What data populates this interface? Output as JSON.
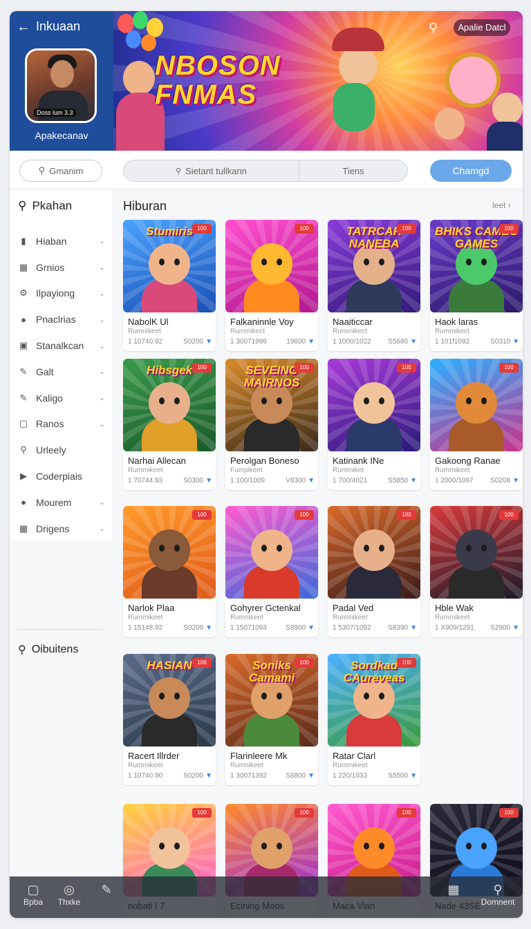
{
  "header": {
    "title": "Inkuaan",
    "profile_name": "Apakecanav",
    "avatar_tag": "Doss lum 3.3",
    "banner_title": "NBOSON FNMAS",
    "banner_pill": "Apalie Datcl"
  },
  "search": {
    "side_placeholder": "Gmanim",
    "main_placeholder": "Sietant tullkann",
    "main_tab": "Tiens",
    "change_button": "Chamgd"
  },
  "sidebar": {
    "heading": "Pkahan",
    "items": [
      {
        "label": "Hiaban",
        "icon": "bookmark-icon",
        "chev": true
      },
      {
        "label": "Grnios",
        "icon": "grid-icon",
        "chev": true
      },
      {
        "label": "Ilpayiong",
        "icon": "gear-icon",
        "chev": true
      },
      {
        "label": "Pnaclrias",
        "icon": "user-icon",
        "chev": true
      },
      {
        "label": "Stanalkcan",
        "icon": "folder-icon",
        "chev": true
      },
      {
        "label": "Galt",
        "icon": "pen-icon",
        "chev": true
      },
      {
        "label": "Kaligo",
        "icon": "pen-icon",
        "chev": true
      },
      {
        "label": "Ranos",
        "icon": "square-icon",
        "chev": true
      },
      {
        "label": "Urleely",
        "icon": "search-user-icon",
        "chev": false
      },
      {
        "label": "Coderpiais",
        "icon": "play-icon",
        "chev": false
      },
      {
        "label": "Mourem",
        "icon": "user-icon",
        "chev": true
      },
      {
        "label": "Drigens",
        "icon": "grid-icon",
        "chev": true
      }
    ],
    "footer": "Oibuitens"
  },
  "main": {
    "section_title": "Hiburan",
    "section_more": "leet"
  },
  "cards": [
    {
      "name": "NabolK Ul",
      "sub": "Rumnikeet",
      "count": "1 10740.92",
      "size": "S0200",
      "tag": "100",
      "thumb_text": "Stumiris",
      "bg": [
        "#4aa3ff",
        "#1a4fb5"
      ],
      "face": "#f0b48a",
      "body": "#d94a7a"
    },
    {
      "name": "Falkaninnle Voy",
      "sub": "Rummikect",
      "count": "1 30071999",
      "size": "19600",
      "tag": "100",
      "thumb_text": "",
      "bg": [
        "#ff4fcf",
        "#b2188f"
      ],
      "face": "#ffb830",
      "body": "#ff8a1f"
    },
    {
      "name": "Naaiticcar",
      "sub": "Rummikect",
      "count": "1 1000/1022",
      "size": "S5680",
      "tag": "100",
      "thumb_text": "TATRCAR NANEBA",
      "bg": [
        "#8a3ad9",
        "#321a7a"
      ],
      "face": "#e3b08a",
      "body": "#2d3a5c"
    },
    {
      "name": "Haok laras",
      "sub": "Rummikect",
      "count": "1 101f1092",
      "size": "S0310",
      "tag": "100",
      "thumb_text": "BHIKS CAMBS GAMES",
      "bg": [
        "#6a3ac9",
        "#2a1a6a"
      ],
      "face": "#4cc96a",
      "body": "#3a7a3a"
    },
    {
      "name": "Narhai Allecan",
      "sub": "Rummikeet",
      "count": "1 70744.93",
      "size": "S0300",
      "tag": "100",
      "thumb_text": "Hibsgek",
      "bg": [
        "#3a9a4a",
        "#1a5a2a"
      ],
      "face": "#e8b08a",
      "body": "#e0a02a"
    },
    {
      "name": "Perolgan Boneso",
      "sub": "Fumpikeet",
      "count": "1 100/1009",
      "size": "V8300",
      "tag": "100",
      "thumb_text": "SEVEING MAIRNOS",
      "bg": [
        "#d98a2a",
        "#3a2a1a"
      ],
      "face": "#c98a5a",
      "body": "#2a2a2a"
    },
    {
      "name": "Katinank INe",
      "sub": "Rummiket",
      "count": "1 700/4021",
      "size": "S5850",
      "tag": "100",
      "thumb_text": "",
      "bg": [
        "#a83ad9",
        "#2a1a7a"
      ],
      "face": "#f0c39a",
      "body": "#2a3a6a"
    },
    {
      "name": "Gakoong Ranae",
      "sub": "Rummikeet",
      "count": "1 2000/1097",
      "size": "S0208",
      "tag": "100",
      "thumb_text": "",
      "bg": [
        "#2ab0ff",
        "#c9308a"
      ],
      "face": "#e08a3a",
      "body": "#a85a2a"
    },
    {
      "name": "Narlok Plaa",
      "sub": "Rummikeet",
      "count": "1 15148.92",
      "size": "S0209",
      "tag": "100",
      "thumb_text": "",
      "bg": [
        "#ff9a2a",
        "#e05a1a"
      ],
      "face": "#8a5a3a",
      "body": "#6a3a2a"
    },
    {
      "name": "Gohyrer Gctenkal",
      "sub": "Rumnikeet",
      "count": "1 15071093",
      "size": "S8900",
      "tag": "100",
      "thumb_text": "",
      "bg": [
        "#ff5acf",
        "#3a6ad9"
      ],
      "face": "#f0b48a",
      "body": "#d93a2a"
    },
    {
      "name": "Padal Ved",
      "sub": "Rummikeet",
      "count": "1 5307/1092",
      "size": "S8390",
      "tag": "100",
      "thumb_text": "",
      "bg": [
        "#d96a2a",
        "#3a1a1a"
      ],
      "face": "#e8b08a",
      "body": "#2a2a3a"
    },
    {
      "name": "Hble Wak",
      "sub": "Rummikeet",
      "count": "1 X909/1291",
      "size": "S2900",
      "tag": "100",
      "thumb_text": "",
      "bg": [
        "#d93a3a",
        "#1a1a2a"
      ],
      "face": "#3a3a4a",
      "body": "#2a2a2a"
    },
    {
      "name": "Racert Illrder",
      "sub": "Rummikeet",
      "count": "1 10740.90",
      "size": "S0200",
      "tag": "100",
      "thumb_text": "HASIAN",
      "bg": [
        "#5a6a8a",
        "#2a3a4a"
      ],
      "face": "#c98a5a",
      "body": "#2a2a2a"
    },
    {
      "name": "Flarinleere Mk",
      "sub": "Rumnikeet",
      "count": "1 30071392",
      "size": "S8800",
      "tag": "100",
      "thumb_text": "Soniks Camami",
      "bg": [
        "#d96a2a",
        "#5a2a1a"
      ],
      "face": "#e0a06a",
      "body": "#4a8a3a"
    },
    {
      "name": "Ratar Clarl",
      "sub": "Rummikeet",
      "count": "1 220/1033",
      "size": "S5500",
      "tag": "100",
      "thumb_text": "Sordkad CAureveas",
      "bg": [
        "#4ab0ff",
        "#3a9a3a"
      ],
      "face": "#f0b48a",
      "body": "#d93a3a"
    },
    {
      "name": "nobati I 7",
      "sub": "",
      "count": "",
      "size": "",
      "tag": "100",
      "thumb_text": "",
      "bg": [
        "#ffd23a",
        "#ff5acf"
      ],
      "face": "#f0c39a",
      "body": "#3a8a5a"
    },
    {
      "name": "Ecining Moos",
      "sub": "",
      "count": "",
      "size": "",
      "tag": "100",
      "thumb_text": "",
      "bg": [
        "#ff8a2a",
        "#9a2ad9"
      ],
      "face": "#e0a06a",
      "body": "#a82a6a"
    },
    {
      "name": "Maca Vian",
      "sub": "",
      "count": "",
      "size": "",
      "tag": "100",
      "thumb_text": "",
      "bg": [
        "#ff5acf",
        "#c91a8a"
      ],
      "face": "#ff8a2a",
      "body": "#e05a1a"
    },
    {
      "name": "Nade 43SE",
      "sub": "",
      "count": "",
      "size": "",
      "tag": "100",
      "thumb_text": "",
      "bg": [
        "#2a2a3a",
        "#0a0a1a"
      ],
      "face": "#4aa3ff",
      "body": "#2a7ad9"
    }
  ],
  "bottom_bar": {
    "items": [
      {
        "label": "Bpba",
        "icon": "square-icon"
      },
      {
        "label": "Thxke",
        "icon": "target-icon"
      },
      {
        "label": "",
        "icon": "pen-icon"
      },
      {
        "label": "",
        "icon": "grid-icon"
      },
      {
        "label": "Domnent",
        "icon": "search-icon"
      }
    ]
  }
}
